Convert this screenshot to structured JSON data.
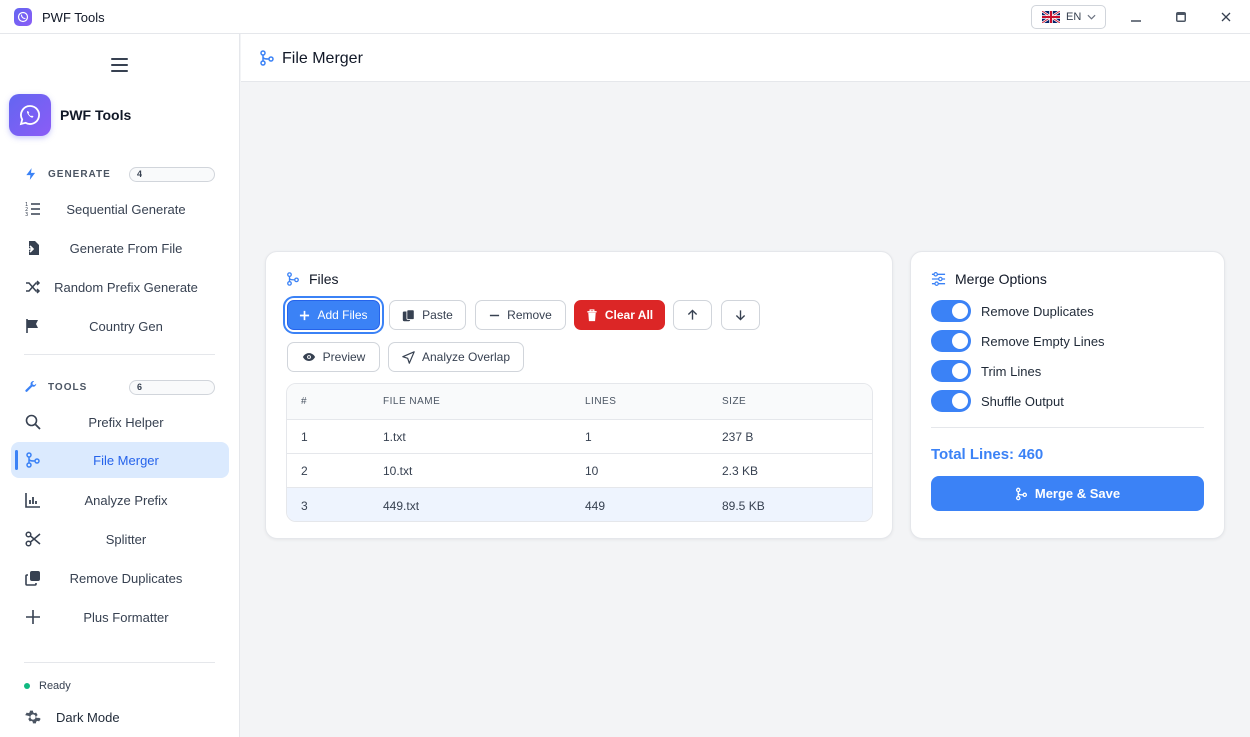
{
  "window": {
    "title": "PWF Tools",
    "language": "EN"
  },
  "sidebar": {
    "brand": "PWF Tools",
    "sections": {
      "generate": {
        "label": "GENERATE",
        "count": "4"
      },
      "tools": {
        "label": "TOOLS",
        "count": "6"
      }
    },
    "items": [
      {
        "label": "Sequential Generate",
        "icon": "list-ordered-icon"
      },
      {
        "label": "Generate From File",
        "icon": "file-import-icon"
      },
      {
        "label": "Random Prefix Generate",
        "icon": "shuffle-icon"
      },
      {
        "label": "Country Gen",
        "icon": "flag-icon"
      },
      {
        "label": "Prefix Helper",
        "icon": "search-icon"
      },
      {
        "label": "File Merger",
        "icon": "merge-icon",
        "active": true
      },
      {
        "label": "Analyze Prefix",
        "icon": "bar-chart-icon"
      },
      {
        "label": "Splitter",
        "icon": "scissors-icon"
      },
      {
        "label": "Remove Duplicates",
        "icon": "copy-icon"
      },
      {
        "label": "Plus Formatter",
        "icon": "plus-icon"
      }
    ],
    "status": "Ready",
    "dark_mode": "Dark Mode"
  },
  "page": {
    "title": "File Merger"
  },
  "files": {
    "title": "Files",
    "buttons": {
      "add": "Add Files",
      "paste": "Paste",
      "remove": "Remove",
      "clear": "Clear All",
      "preview": "Preview",
      "analyze": "Analyze Overlap"
    },
    "columns": [
      "#",
      "FILE NAME",
      "LINES",
      "SIZE"
    ],
    "rows": [
      {
        "num": "1",
        "name": "1.txt",
        "lines": "1",
        "size": "237 B"
      },
      {
        "num": "2",
        "name": "10.txt",
        "lines": "10",
        "size": "2.3 KB"
      },
      {
        "num": "3",
        "name": "449.txt",
        "lines": "449",
        "size": "89.5 KB",
        "selected": true
      }
    ]
  },
  "options": {
    "title": "Merge Options",
    "toggles": [
      {
        "label": "Remove Duplicates",
        "on": true
      },
      {
        "label": "Remove Empty Lines",
        "on": true
      },
      {
        "label": "Trim Lines",
        "on": true
      },
      {
        "label": "Shuffle Output",
        "on": true
      }
    ],
    "total": "Total Lines: 460",
    "merge_label": "Merge & Save"
  },
  "colors": {
    "accent": "#3b82f6",
    "danger": "#dc2626",
    "active_bg": "#dbeafe",
    "status_ok": "#10b981"
  }
}
